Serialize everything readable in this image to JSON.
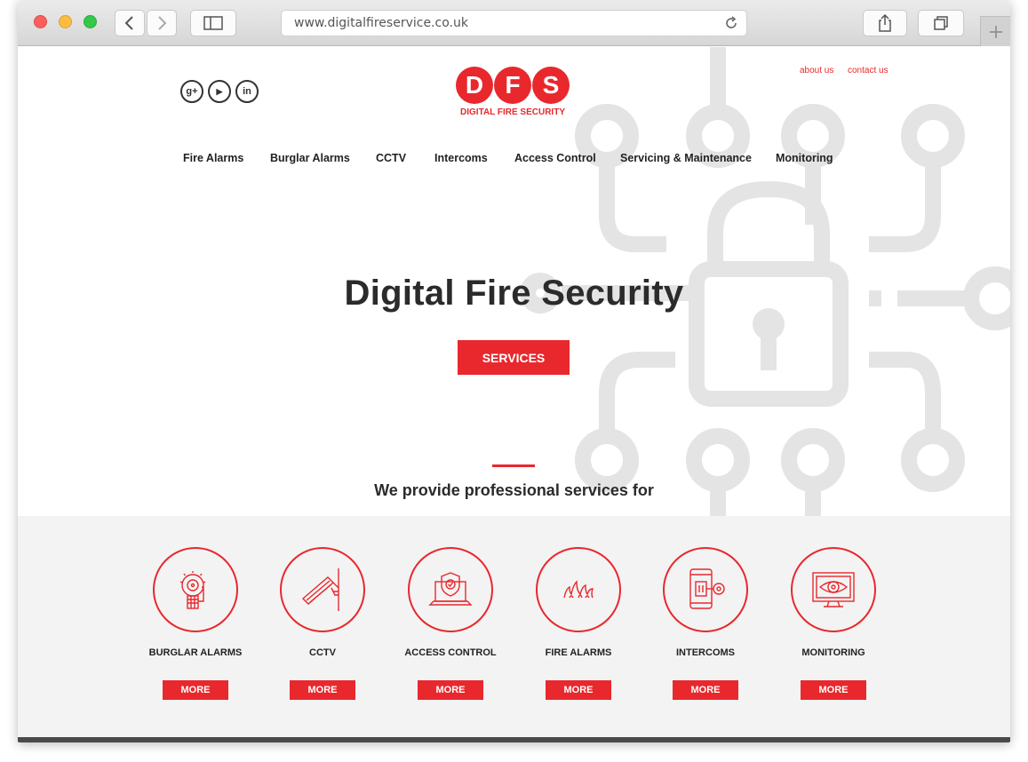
{
  "browser": {
    "url": "www.digitalfireservice.co.uk"
  },
  "site": {
    "logo_letters": [
      "D",
      "F",
      "S"
    ],
    "logo_tagline": "DIGITAL FIRE SECURITY",
    "social": [
      "google-plus-icon",
      "youtube-icon",
      "linkedin-icon"
    ],
    "social_glyphs": [
      "g+",
      "▶",
      "in"
    ],
    "top_links": [
      "about us",
      "contact us"
    ],
    "nav": [
      "Fire Alarms",
      "Burglar Alarms",
      "CCTV",
      "Intercoms",
      "Access Control",
      "Servicing & Maintenance",
      "Monitoring"
    ]
  },
  "hero": {
    "title": "Digital Fire Security",
    "button": "SERVICES"
  },
  "intro": {
    "subtitle": "We provide professional services for"
  },
  "services": [
    {
      "label": "BURGLAR ALARMS",
      "icon": "alarm-bell-icon",
      "more": "MORE"
    },
    {
      "label": "CCTV",
      "icon": "cctv-camera-icon",
      "more": "MORE"
    },
    {
      "label": "ACCESS CONTROL",
      "icon": "laptop-shield-icon",
      "more": "MORE"
    },
    {
      "label": "FIRE ALARMS",
      "icon": "flame-icon",
      "more": "MORE"
    },
    {
      "label": "INTERCOMS",
      "icon": "phone-key-icon",
      "more": "MORE"
    },
    {
      "label": "MONITORING",
      "icon": "monitor-eye-icon",
      "more": "MORE"
    }
  ],
  "colors": {
    "accent": "#e8282d",
    "text": "#2b2b2b",
    "section_bg": "#f3f3f3",
    "art": "#e4e4e4"
  }
}
